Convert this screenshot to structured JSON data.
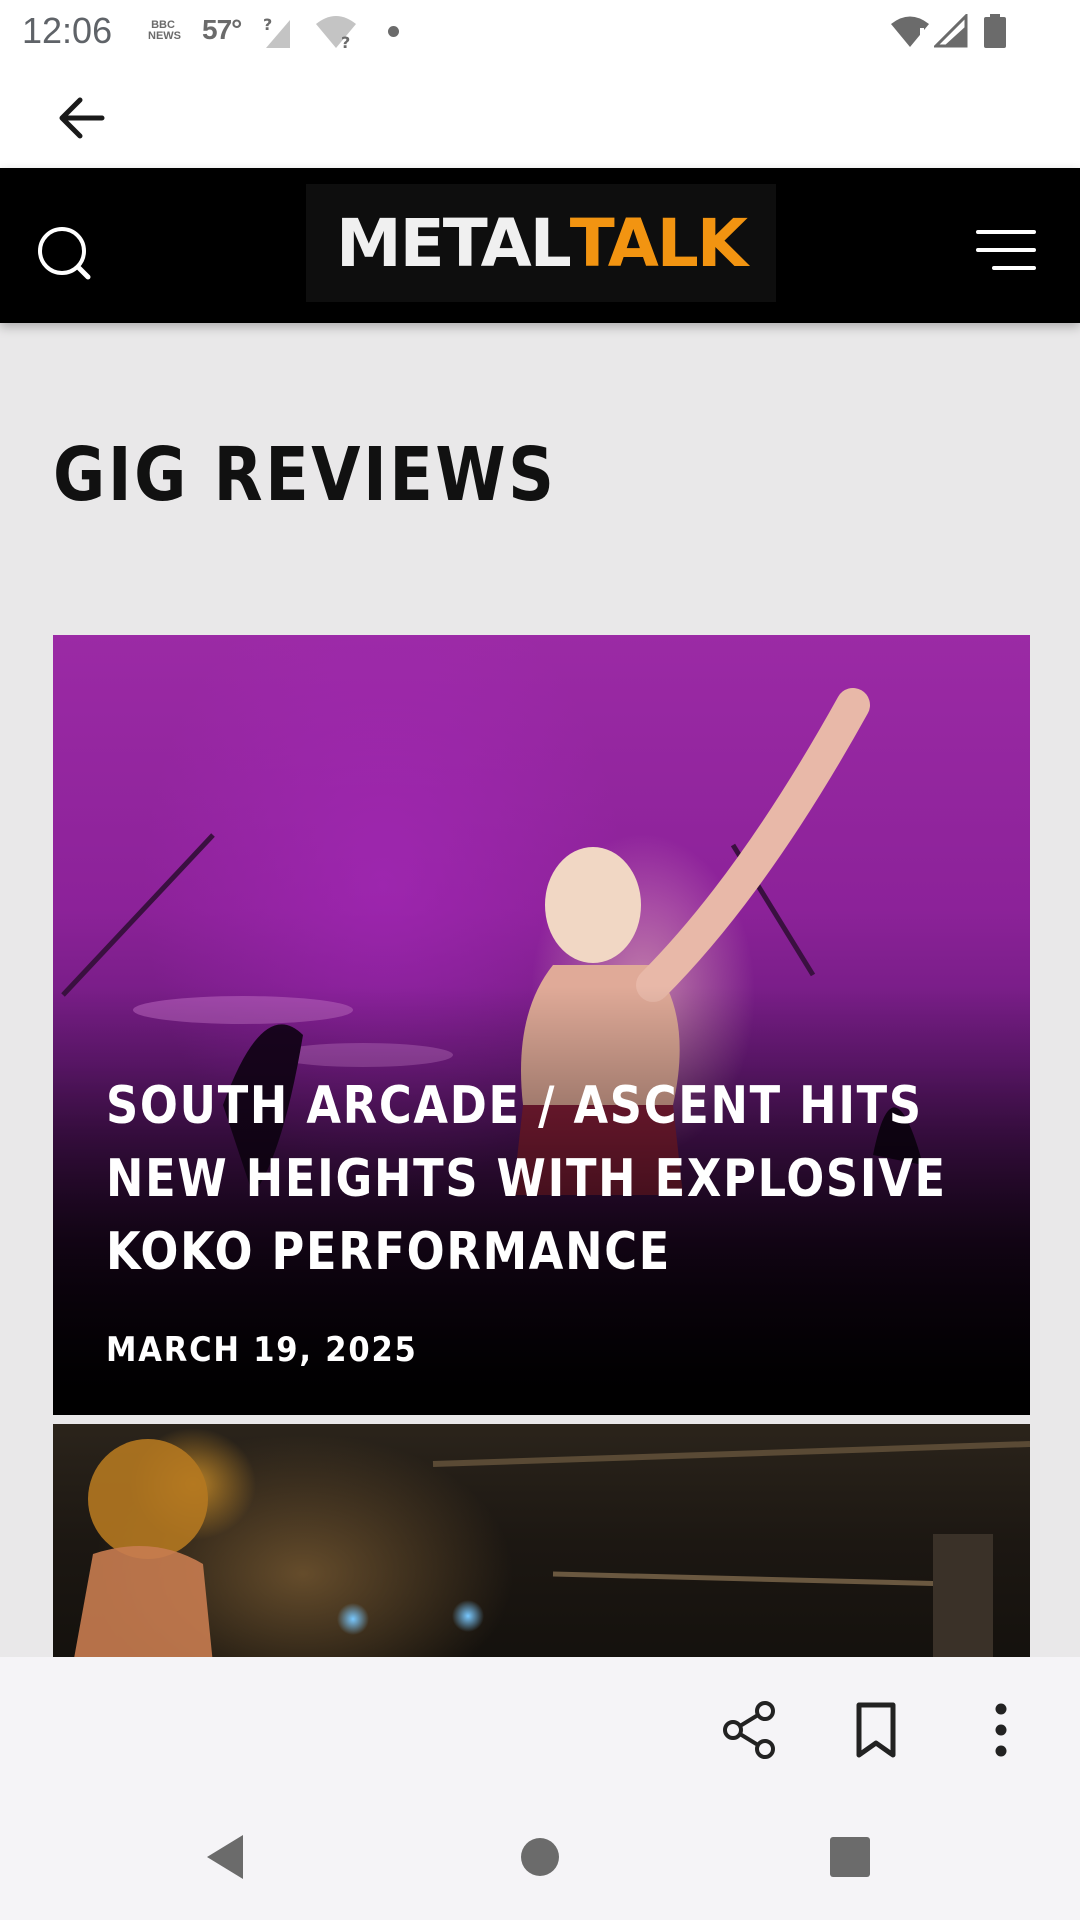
{
  "status_bar": {
    "time": "12:06",
    "news_badge_line1": "BBC",
    "news_badge_line2": "NEWS",
    "temperature": "57°",
    "icons": [
      "news-icon",
      "no-signal-icon",
      "wifi-question-icon",
      "notification-dot-icon",
      "wifi-icon",
      "cell-signal-icon",
      "battery-icon"
    ]
  },
  "app_bar": {
    "icons": [
      "back-arrow-icon"
    ]
  },
  "header": {
    "logo_part1": "METAL",
    "logo_part2": "TALK",
    "icons": [
      "search-icon",
      "hamburger-menu-icon"
    ],
    "colors": {
      "background": "#000000",
      "logo_accent": "#f29411"
    }
  },
  "main": {
    "section_title": "GIG REVIEWS",
    "articles": [
      {
        "title": "SOUTH ARCADE / ASCENT HITS NEW HEIGHTS WITH EXPLOSIVE KOKO PERFORMANCE",
        "date": "MARCH 19, 2025"
      }
    ]
  },
  "bottom_toolbar": {
    "icons": [
      "share-icon",
      "bookmark-icon",
      "more-vert-icon"
    ]
  },
  "nav_bar": {
    "icons": [
      "nav-back-icon",
      "nav-home-icon",
      "nav-recents-icon"
    ]
  }
}
